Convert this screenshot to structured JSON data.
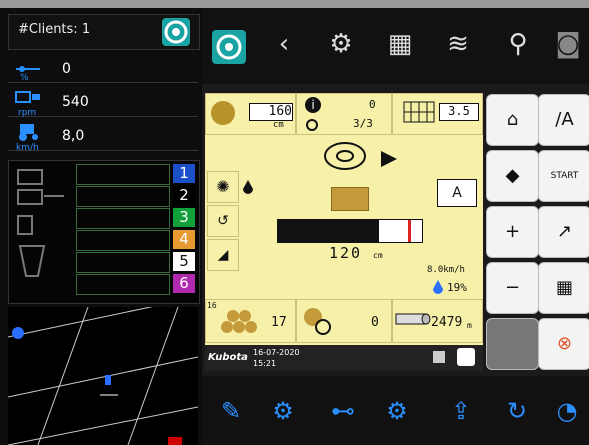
{
  "left": {
    "clients_label": "#Clients:  1",
    "sensors": [
      {
        "label": "%",
        "value": "0"
      },
      {
        "label": "rpm",
        "value": "540"
      },
      {
        "label": "km/h",
        "value": "8,0"
      }
    ],
    "sections": [
      "1",
      "2",
      "3",
      "4",
      "5",
      "6"
    ],
    "section_colors": [
      "#1c50c8",
      "#000000",
      "#12a03a",
      "#e69a2f",
      "#ffffff",
      "#b02ab0"
    ]
  },
  "main": {
    "bale_diameter": "160",
    "bale_unit": "cm",
    "info_count": "0",
    "fraction": "3/3",
    "net_value": "3.5",
    "mode_button": "A",
    "progress_value": "120",
    "progress_unit": "cm",
    "progress_fraction": 0.7,
    "speed": "8.0km/h",
    "moisture": "19%",
    "bale_count_small": "16",
    "bale_count": "17",
    "timer_count": "0",
    "length_value": "2479",
    "length_unit": "m",
    "brand": "Kubota",
    "date": "16-07-2020",
    "time": "15:21"
  },
  "right_buttons": {
    "slash_a": "/A",
    "start": "START"
  }
}
